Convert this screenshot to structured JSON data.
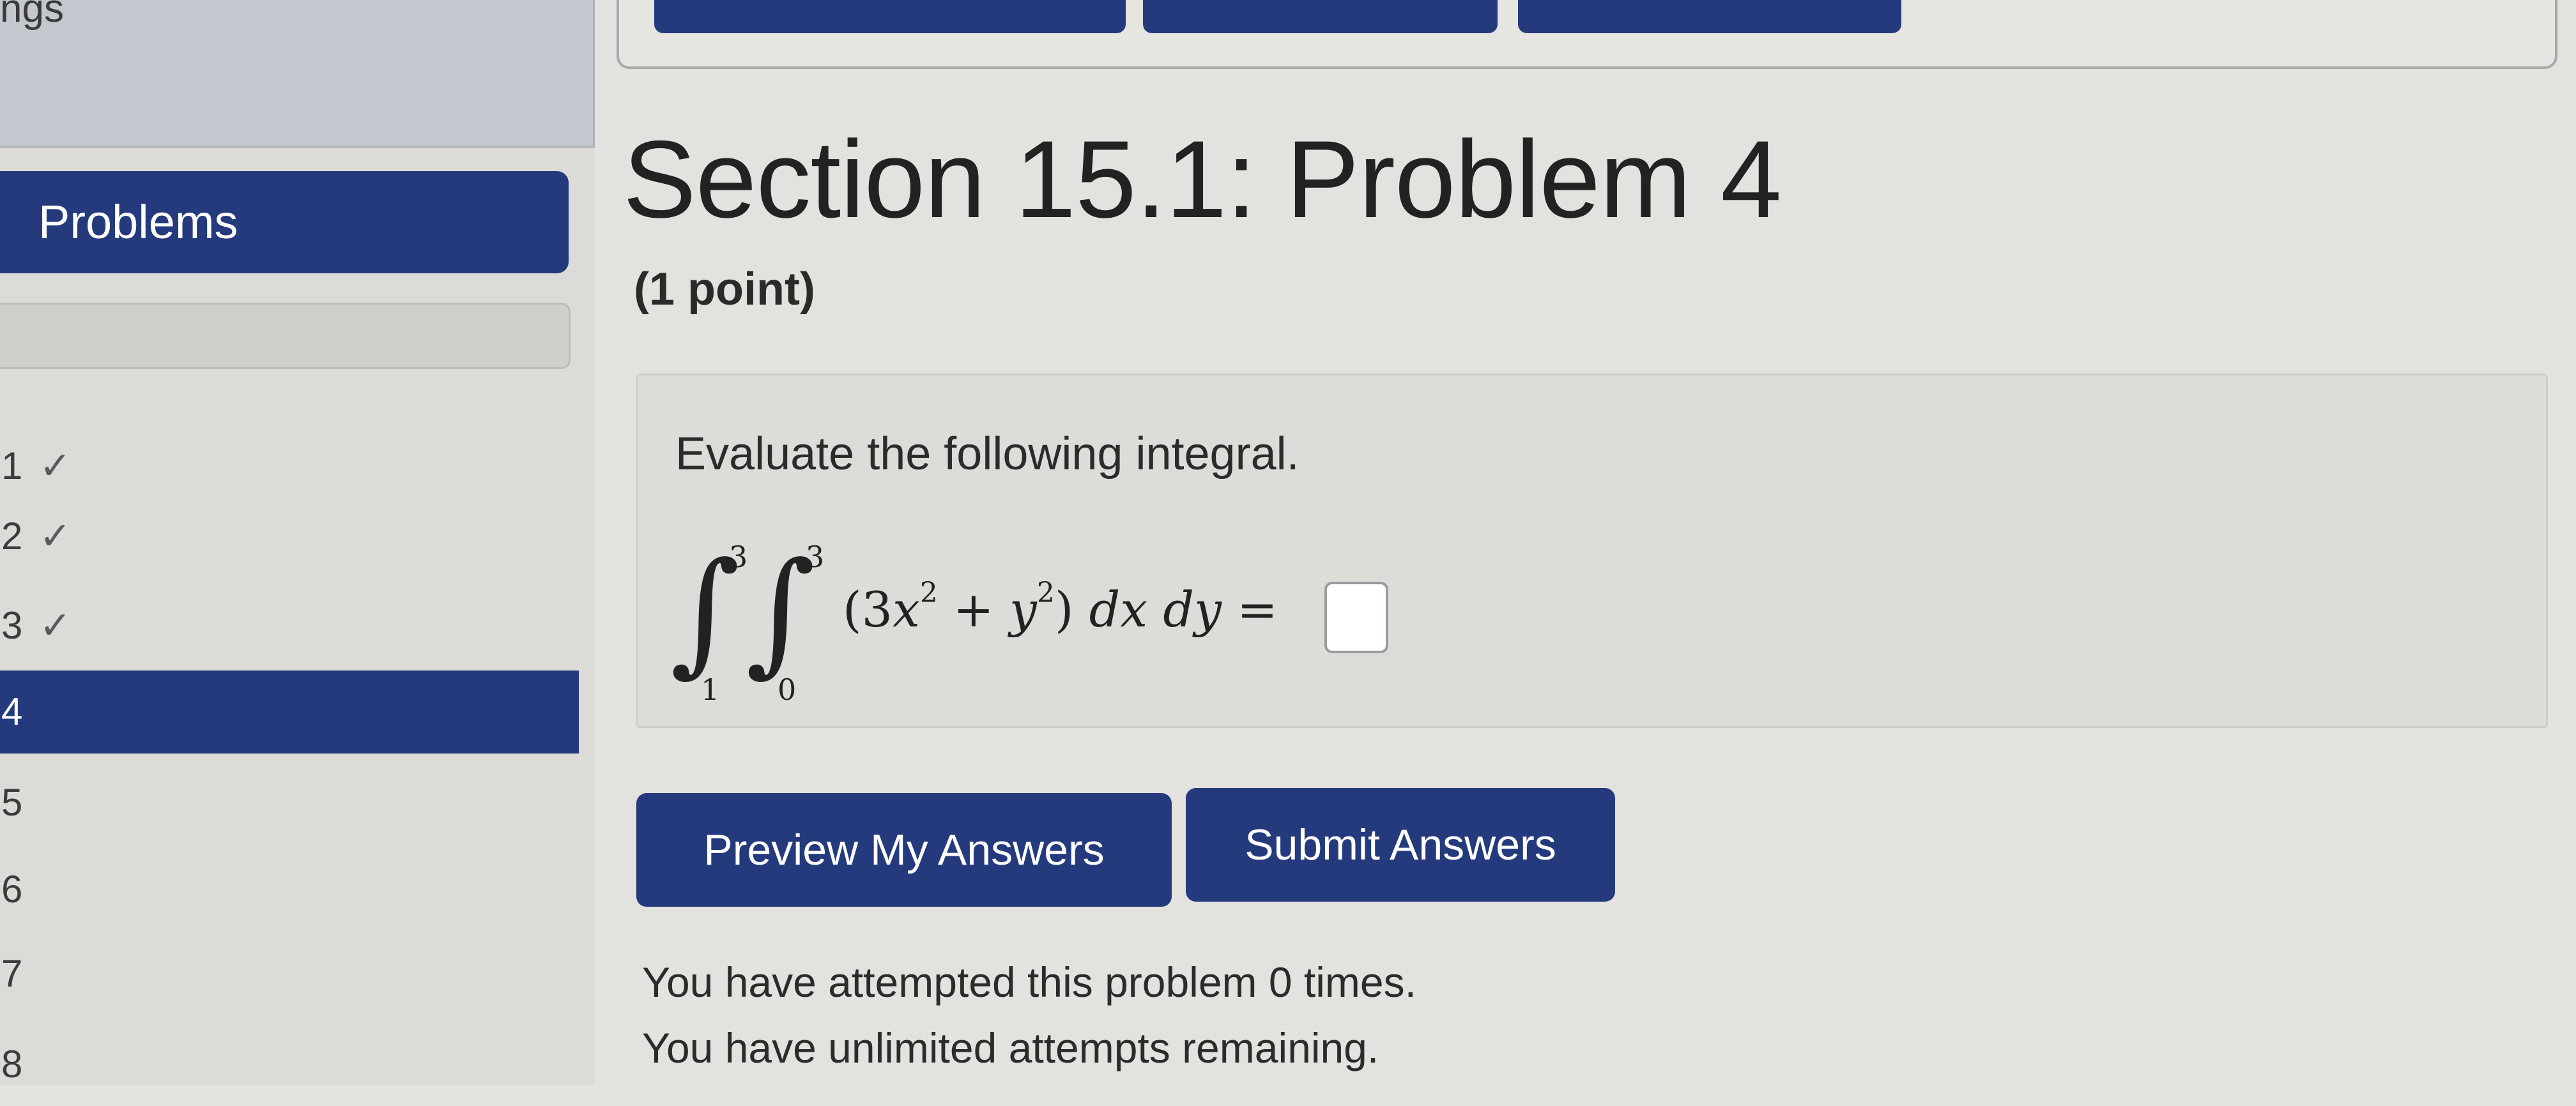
{
  "sidebar": {
    "top_label": "ngs",
    "header": "Problems",
    "items": [
      {
        "num": "1",
        "check": "✓"
      },
      {
        "num": "2",
        "check": "✓"
      },
      {
        "num": "3",
        "check": "✓"
      },
      {
        "num": "4",
        "check": ""
      },
      {
        "num": "5",
        "check": ""
      },
      {
        "num": "6",
        "check": ""
      },
      {
        "num": "7",
        "check": ""
      },
      {
        "num": "8",
        "check": ""
      }
    ],
    "active_item": "4"
  },
  "problem": {
    "title": "Section 15.1: Problem 4",
    "points": "(1 point)",
    "prompt": "Evaluate the following integral.",
    "integral": {
      "outer_upper": "3",
      "outer_lower": "1",
      "inner_upper": "3",
      "inner_lower": "0",
      "open": "(3",
      "x": "x",
      "x_exp": "2",
      "plus": " + ",
      "y": "y",
      "y_exp": "2",
      "close": ")",
      "differentials": " dx dy ",
      "equals": "="
    },
    "answer_value": ""
  },
  "buttons": {
    "preview": "Preview My Answers",
    "submit": "Submit Answers"
  },
  "status": {
    "attempted": "You have attempted this problem 0 times.",
    "remaining": "You have unlimited attempts remaining."
  },
  "colors": {
    "accent": "#243a7d",
    "background": "#e3e2df"
  }
}
